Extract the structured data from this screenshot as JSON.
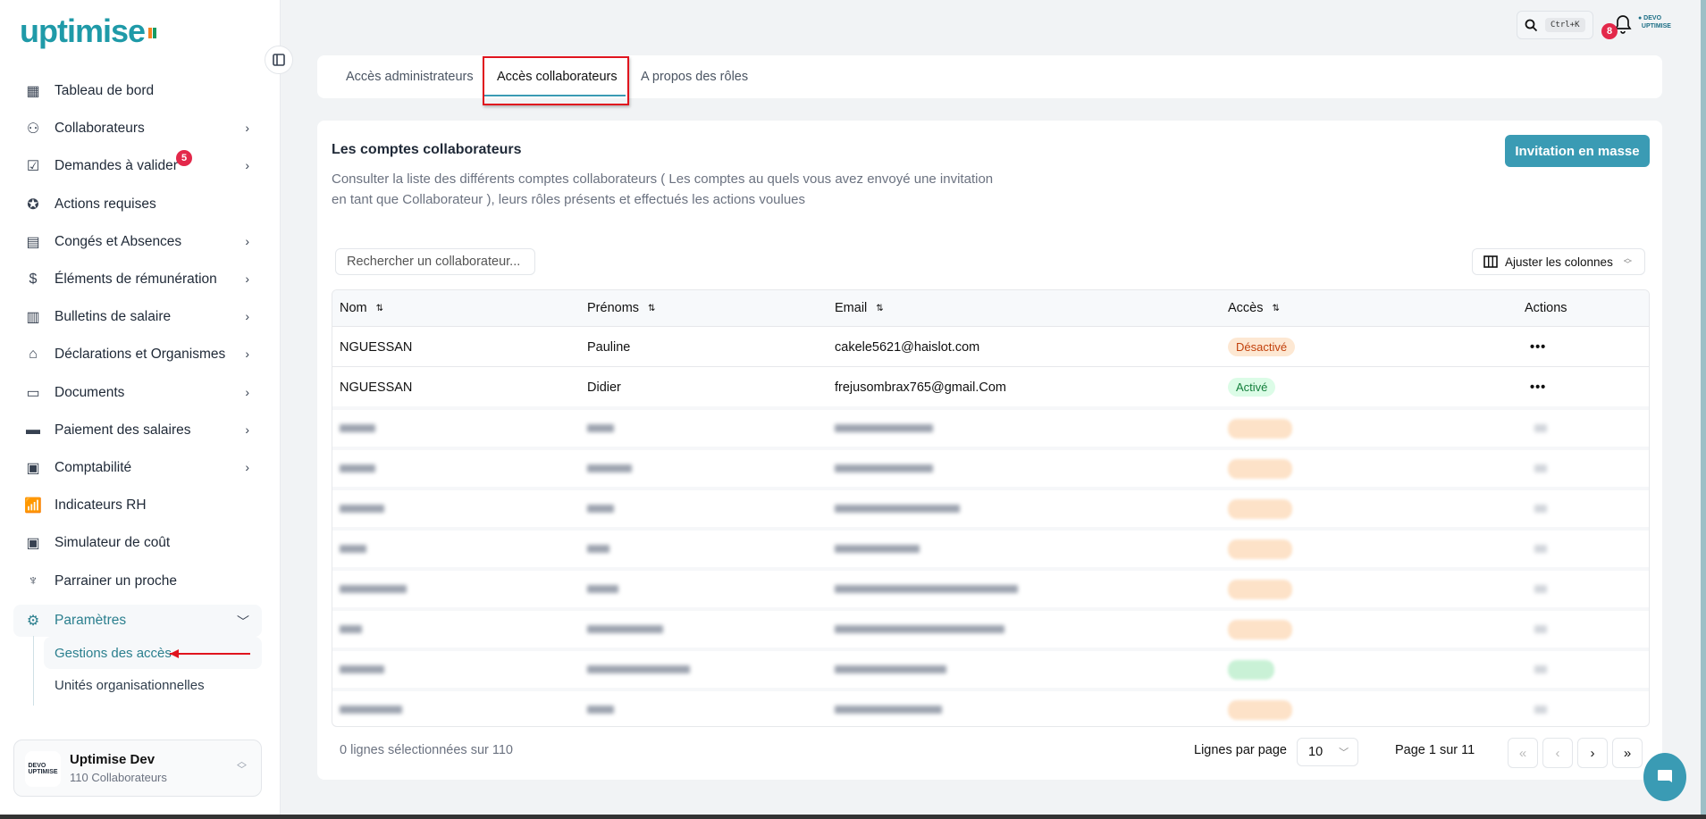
{
  "brand": {
    "logo_text": "uptimise",
    "accent": "#3a9bb4",
    "flag_colors": [
      "#f58220",
      "#ffffff",
      "#169b62"
    ]
  },
  "sidebar": {
    "items": [
      {
        "label": "Tableau de bord",
        "icon": "dashboard-icon",
        "chevron": false
      },
      {
        "label": "Collaborateurs",
        "icon": "users-icon",
        "chevron": true
      },
      {
        "label": "Demandes à valider",
        "icon": "checklist-icon",
        "chevron": true,
        "badge": "5"
      },
      {
        "label": "Actions requises",
        "icon": "badge-check-icon",
        "chevron": false
      },
      {
        "label": "Congés et Absences",
        "icon": "calendar-icon",
        "chevron": true
      },
      {
        "label": "Éléments de rémunération",
        "icon": "money-icon",
        "chevron": true
      },
      {
        "label": "Bulletins de salaire",
        "icon": "payslip-icon",
        "chevron": true
      },
      {
        "label": "Déclarations et Organismes",
        "icon": "building-icon",
        "chevron": true
      },
      {
        "label": "Documents",
        "icon": "folder-icon",
        "chevron": true
      },
      {
        "label": "Paiement des salaires",
        "icon": "card-gear-icon",
        "chevron": true
      },
      {
        "label": "Comptabilité",
        "icon": "calculator-icon",
        "chevron": true
      },
      {
        "label": "Indicateurs RH",
        "icon": "chart-icon",
        "chevron": false
      },
      {
        "label": "Simulateur de coût",
        "icon": "calculator-icon",
        "chevron": false
      },
      {
        "label": "Parrainer un proche",
        "icon": "medal-icon",
        "chevron": false
      },
      {
        "label": "Paramètres",
        "icon": "gear-icon",
        "chevron": true,
        "open": true
      }
    ],
    "sub_items": [
      {
        "label": "Gestions des accès",
        "active": true
      },
      {
        "label": "Unités organisationnelles",
        "active": false
      }
    ],
    "org": {
      "name": "Uptimise Dev",
      "count": "110 Collaborateurs",
      "logo_text": "DEVO UPTIMISE"
    }
  },
  "topbar": {
    "search_shortcut": "Ctrl+K",
    "notifications": "8",
    "logo_text": "DEVO UPTIMISE"
  },
  "tabs": [
    {
      "label": "Accès administrateurs"
    },
    {
      "label": "Accès collaborateurs",
      "active": true
    },
    {
      "label": "A propos des rôles"
    }
  ],
  "main": {
    "title": "Les comptes collaborateurs",
    "description_1": "Consulter la liste des différents comptes collaborateurs ( Les comptes au quels vous avez envoyé une invitation",
    "description_2": "en tant que Collaborateur ), leurs rôles présents et effectués les actions voulues",
    "invite_button": "Invitation en masse",
    "search_placeholder": "Rechercher un collaborateur...",
    "columns_button": "Ajuster les colonnes"
  },
  "table": {
    "columns": [
      "Nom",
      "Prénoms",
      "Email",
      "Accès",
      "Actions"
    ],
    "rows": [
      {
        "nom": "NGUESSAN",
        "prenoms": "Pauline",
        "email": "cakele5621@haislot.com",
        "acces": "Désactivé",
        "state": "off"
      },
      {
        "nom": "NGUESSAN",
        "prenoms": "Didier",
        "email": "frejusombrax765@gmail.Com",
        "acces": "Activé",
        "state": "on"
      }
    ],
    "blurred_rows_states": [
      "off",
      "off",
      "off",
      "off",
      "off",
      "off",
      "on",
      "off"
    ],
    "status_colors": {
      "off": "#c2410c",
      "on": "#15803d"
    }
  },
  "footer": {
    "selection": "0 lignes sélectionnées sur 110",
    "rows_per_page_label": "Lignes par page",
    "rows_per_page": "10",
    "page_info": "Page 1 sur 11",
    "buttons": [
      "«",
      "‹",
      "›",
      "»"
    ]
  }
}
